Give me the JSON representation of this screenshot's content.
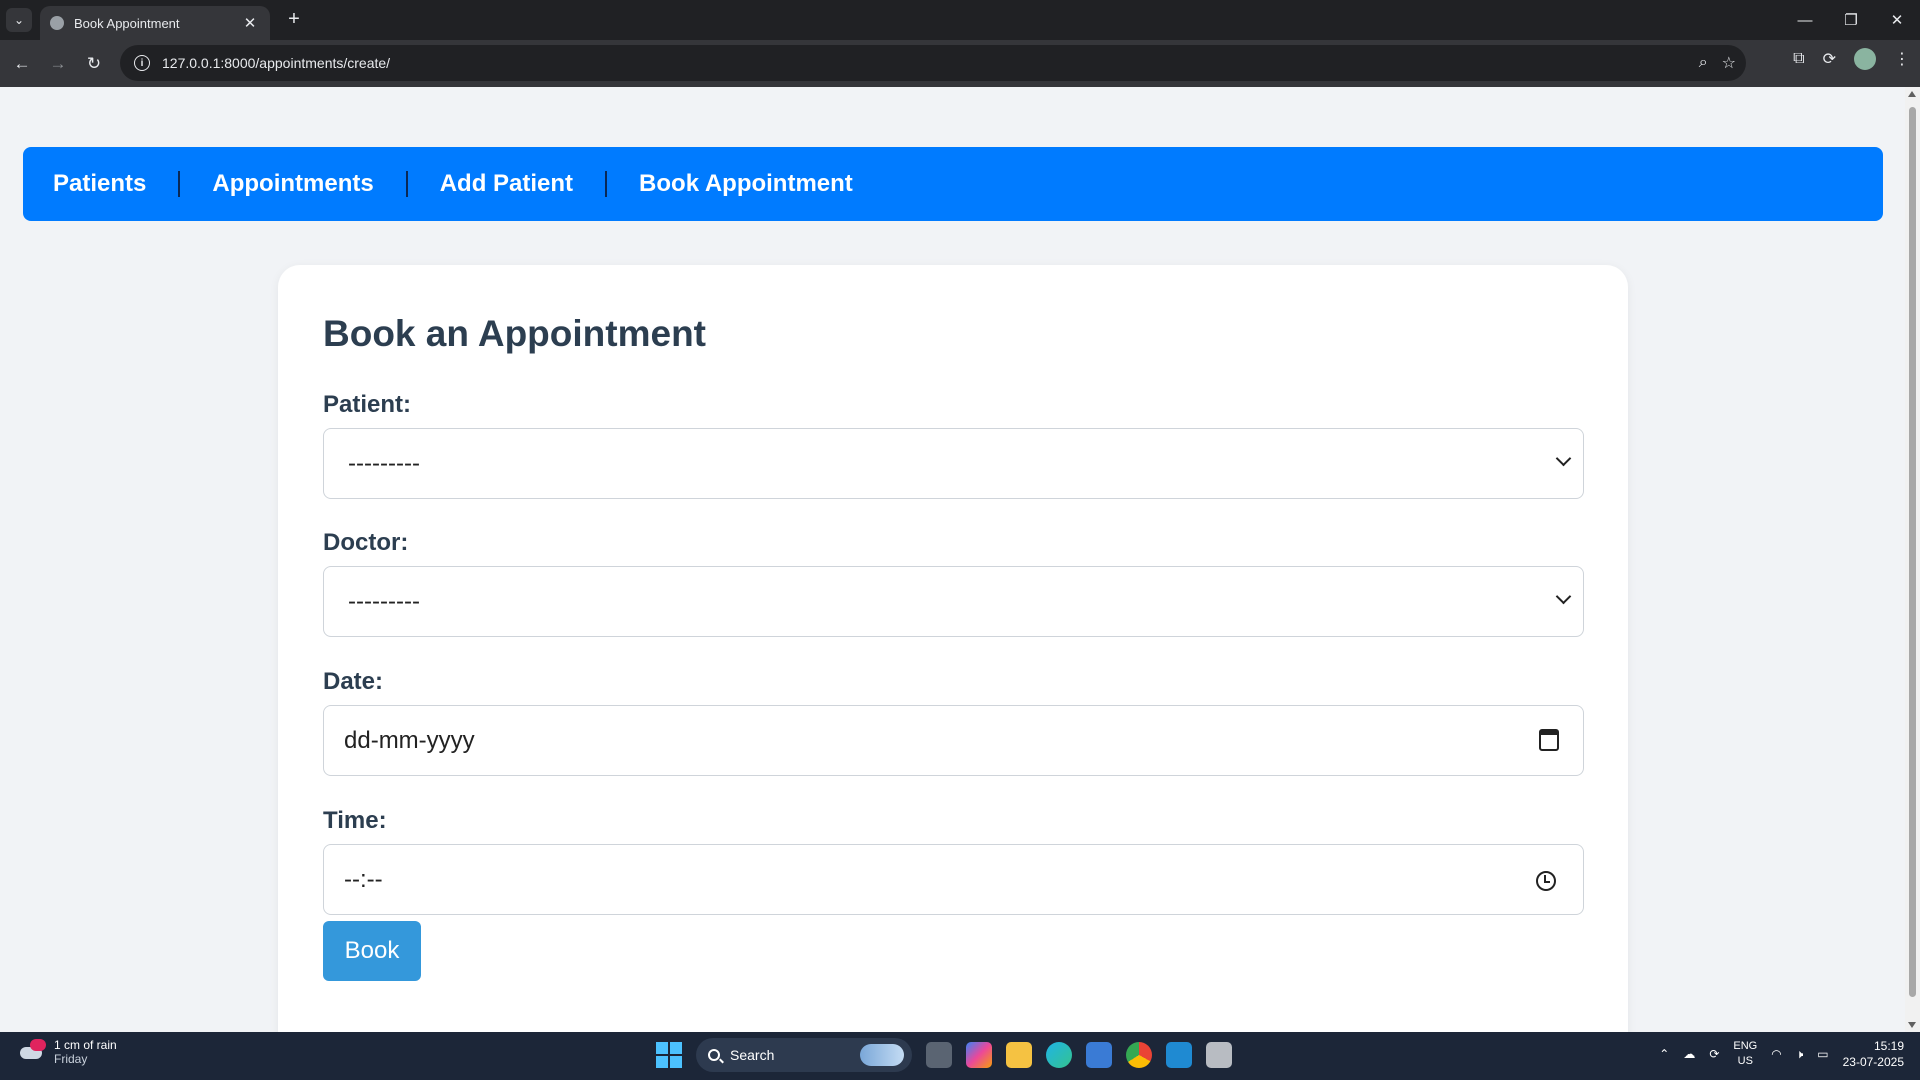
{
  "browser": {
    "tab_title": "Book Appointment",
    "url": "127.0.0.1:8000/appointments/create/"
  },
  "nav": {
    "items": [
      {
        "label": "Patients"
      },
      {
        "label": "Appointments"
      },
      {
        "label": "Add Patient"
      },
      {
        "label": "Book Appointment"
      }
    ]
  },
  "form": {
    "title": "Book an Appointment",
    "patient_label": "Patient:",
    "patient_value": "---------",
    "doctor_label": "Doctor:",
    "doctor_value": "---------",
    "date_label": "Date:",
    "date_value": "dd-mm-yyyy",
    "time_label": "Time:",
    "time_value": "--:--",
    "submit_label": "Book"
  },
  "taskbar": {
    "weather_line1": "1 cm of rain",
    "weather_line2": "Friday",
    "search_label": "Search",
    "lang_line1": "ENG",
    "lang_line2": "US",
    "time": "15:19",
    "date": "23-07-2025"
  },
  "colors": {
    "navbar": "#007bff",
    "button": "#3498db",
    "heading": "#2c3e50"
  }
}
